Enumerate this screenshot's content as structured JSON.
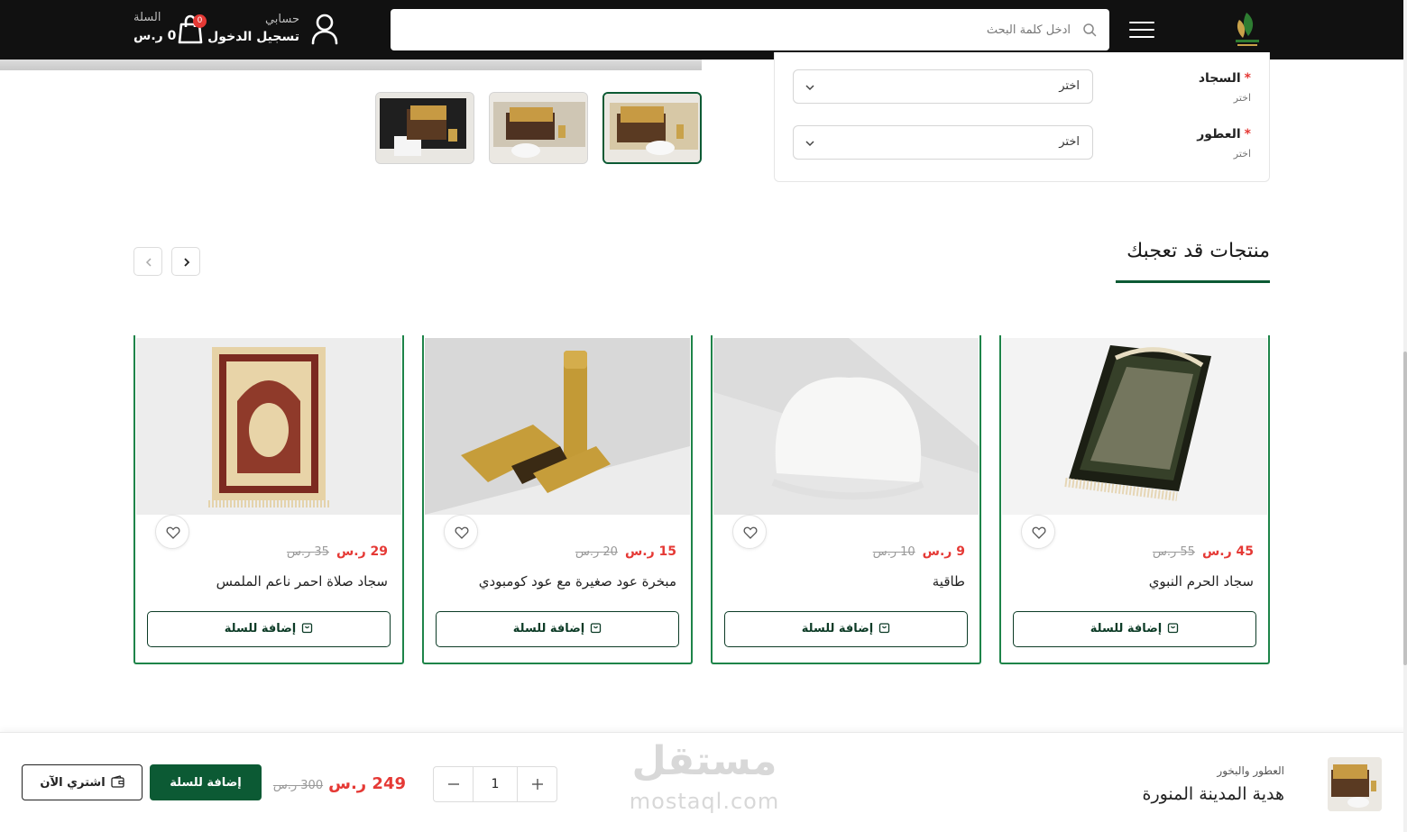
{
  "header": {
    "search_placeholder": "ادخل كلمة البحث",
    "account_label": "حسابي",
    "login_label": "تسجيل الدخول",
    "cart_label": "السلة",
    "cart_total": "0 ر.س",
    "cart_count": "0",
    "icons": [
      "logo",
      "menu-icon",
      "search-icon",
      "user-icon",
      "cart-icon"
    ]
  },
  "options": [
    {
      "label": "السجاد",
      "required_mark": "*",
      "hint": "اختر",
      "select_value": "اختر"
    },
    {
      "label": "العطور",
      "required_mark": "*",
      "hint": "اختر",
      "select_value": "اختر"
    }
  ],
  "related": {
    "title": "منتجات قد تعجبك",
    "products": [
      {
        "name": "سجاد الحرم النبوي",
        "price": "45 ر.س",
        "old_price": "55 ر.س",
        "add_label": "إضافة للسلة"
      },
      {
        "name": "طاقية",
        "price": "9 ر.س",
        "old_price": "10 ر.س",
        "add_label": "إضافة للسلة"
      },
      {
        "name": "مبخرة عود صغيرة مع عود كومبودي",
        "price": "15 ر.س",
        "old_price": "20 ر.س",
        "add_label": "إضافة للسلة"
      },
      {
        "name": "سجاد صلاة احمر ناعم الملمس",
        "price": "29 ر.س",
        "old_price": "35 ر.س",
        "add_label": "إضافة للسلة"
      }
    ]
  },
  "bottom_bar": {
    "category": "العطور والبخور",
    "product_title": "هدية المدينة المنورة",
    "quantity": "1",
    "price": "249 ر.س",
    "old_price": "300 ر.س",
    "add_to_cart": "إضافة للسلة",
    "buy_now": "اشتري الآن"
  },
  "watermark": {
    "arabic": "مستقل",
    "latin": "mostaql.com"
  },
  "colors": {
    "brand_green": "#0c5a34",
    "card_border": "#1e8449",
    "sale_red": "#e53935",
    "header_bg": "#111111"
  }
}
